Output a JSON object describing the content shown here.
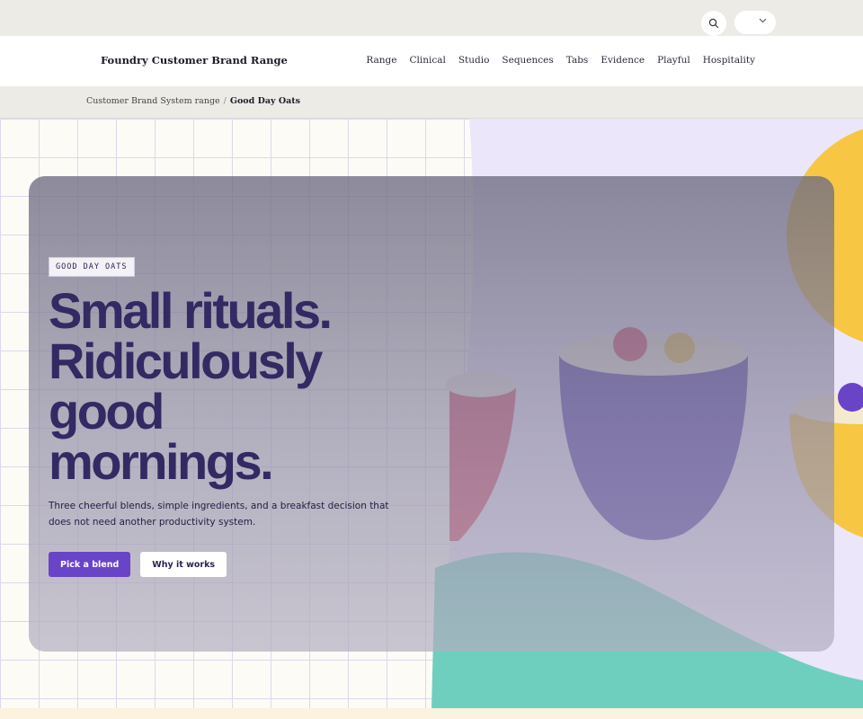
{
  "utility": {
    "search_icon": "search-icon",
    "locale_select_value": ""
  },
  "nav": {
    "site_title": "Foundry Customer Brand Range",
    "links": [
      "Range",
      "Clinical",
      "Studio",
      "Sequences",
      "Tabs",
      "Evidence",
      "Playful",
      "Hospitality"
    ]
  },
  "breadcrumb": {
    "parent": "Customer Brand System range",
    "separator": "/",
    "current": "Good Day Oats"
  },
  "hero": {
    "badge": "GOOD DAY OATS",
    "headline_lines": [
      "Small rituals.",
      "Ridiculously",
      "good",
      "mornings."
    ],
    "subtext": "Three cheerful blends, simple ingredients, and a breakfast decision that does not need another productivity system.",
    "primary_cta": "Pick a blend",
    "secondary_cta": "Why it works"
  },
  "colors": {
    "accent_purple": "#6a44c6",
    "headline_ink": "#332a63",
    "lavender_bg": "#ece6fb",
    "teal": "#6ecfbe",
    "mustard": "#f7c744",
    "raspberry": "#d8405e",
    "bowl_indigo": "#4b36a8"
  }
}
